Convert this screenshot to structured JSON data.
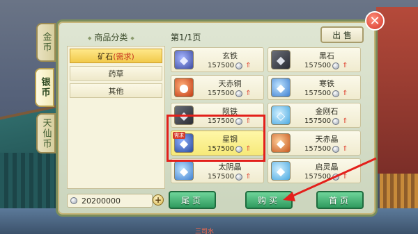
{
  "side_tabs": [
    {
      "label": "金币",
      "active": false
    },
    {
      "label": "银币",
      "active": true
    },
    {
      "label": "天仙币",
      "active": false
    }
  ],
  "header": {
    "category_title": "商品分类",
    "page": "第1/1页",
    "sell_label": "出 售"
  },
  "categories": [
    {
      "label": "矿石",
      "hot": "(需求)",
      "active": true
    },
    {
      "label": "药草",
      "hot": "",
      "active": false
    },
    {
      "label": "其他",
      "hot": "",
      "active": false
    }
  ],
  "items": [
    {
      "name": "玄铁",
      "price": "157500",
      "icon": "ore-blue-icon"
    },
    {
      "name": "黑石",
      "price": "157500",
      "icon": "ore-dark-icon"
    },
    {
      "name": "天赤铜",
      "price": "157500",
      "icon": "ore-red-icon"
    },
    {
      "name": "寒铁",
      "price": "157500",
      "icon": "ore-ice-icon"
    },
    {
      "name": "陨铁",
      "price": "157500",
      "icon": "ore-dark-icon"
    },
    {
      "name": "金刚石",
      "price": "157500",
      "icon": "ore-crystal-icon"
    },
    {
      "name": "星钢",
      "price": "157500",
      "icon": "ore-steel-icon",
      "tag": "需求",
      "selected": true
    },
    {
      "name": "天赤晶",
      "price": "157500",
      "icon": "ore-amber-icon"
    },
    {
      "name": "太阴晶",
      "price": "157500",
      "icon": "ore-ice-icon"
    },
    {
      "name": "启灵晶",
      "price": "157500",
      "icon": "ore-crystal-icon"
    }
  ],
  "footer": {
    "balance": "20200000",
    "prev_label": "尾页",
    "buy_label": "购买",
    "first_label": "首页"
  },
  "misc": {
    "bottom_text": "三司水",
    "close_symbol": "✕",
    "add_symbol": "+",
    "up_symbol": "⇑"
  },
  "colors": {
    "highlight": "#e3201b",
    "button_green": "#2f9a5e",
    "accent_red": "#e04a36"
  }
}
